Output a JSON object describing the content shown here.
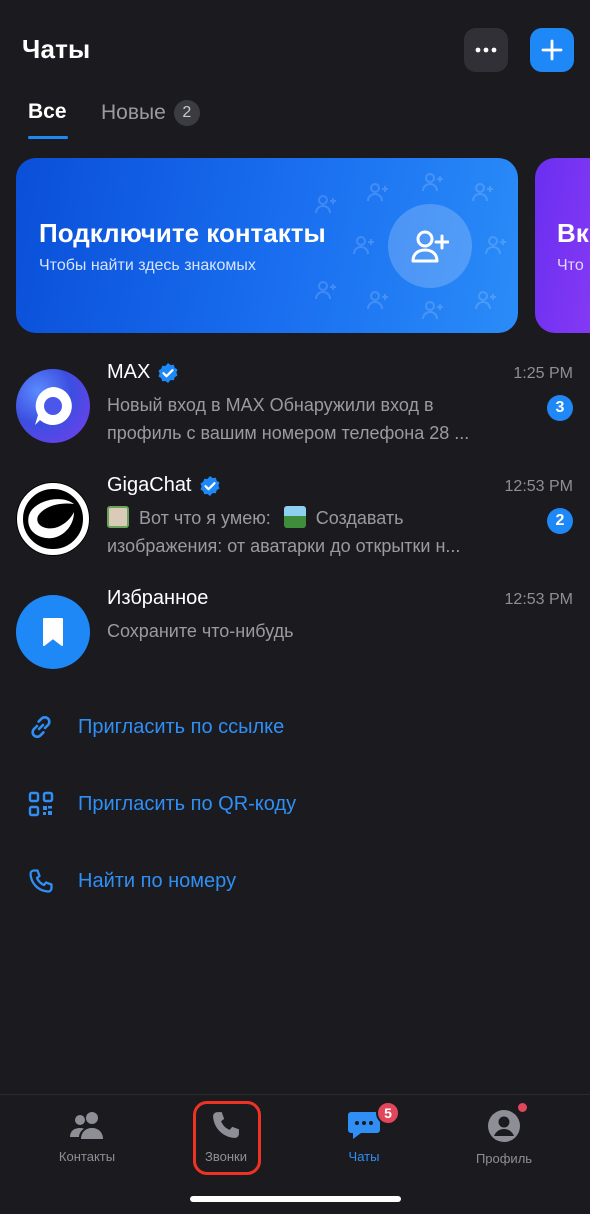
{
  "header": {
    "title": "Чаты",
    "more_icon": "more-horizontal-icon",
    "add_icon": "plus-icon"
  },
  "tabs": [
    {
      "label": "Все",
      "active": true
    },
    {
      "label": "Новые",
      "badge": "2",
      "active": false
    }
  ],
  "banners": [
    {
      "title": "Подключите контакты",
      "subtitle": "Чтобы найти здесь знакомых",
      "icon": "add-contact-icon"
    },
    {
      "title": "Вк",
      "subtitle": "Что"
    }
  ],
  "chats": [
    {
      "name": "MAX",
      "verified": true,
      "time": "1:25 PM",
      "preview_line1": "Новый вход в MAX Обнаружили вход в",
      "preview_line2": "профиль с вашим номером телефона 28 ...",
      "unread": "3"
    },
    {
      "name": "GigaChat",
      "verified": true,
      "time": "12:53 PM",
      "preview_line1": "Вот что я умею:",
      "preview_line1b": "Создавать",
      "preview_line2": "изображения: от аватарки до открытки н...",
      "unread": "2"
    },
    {
      "name": "Избранное",
      "verified": false,
      "time": "12:53 PM",
      "preview_line1": "Сохраните что-нибудь"
    }
  ],
  "actions": [
    {
      "label": "Пригласить по ссылке",
      "icon": "link-icon"
    },
    {
      "label": "Пригласить по QR-коду",
      "icon": "qr-code-icon"
    },
    {
      "label": "Найти по номеру",
      "icon": "phone-icon"
    }
  ],
  "bottom_nav": {
    "items": [
      {
        "label": "Контакты",
        "icon": "contacts-icon"
      },
      {
        "label": "Звонки",
        "icon": "phone-icon"
      },
      {
        "label": "Чаты",
        "icon": "chat-bubble-icon",
        "badge": "5",
        "active": true
      },
      {
        "label": "Профиль",
        "icon": "profile-icon"
      }
    ]
  },
  "colors": {
    "background": "#1b1b1f",
    "accent": "#1e88f7",
    "link": "#2f8ff5",
    "badge_red": "#e0475a",
    "highlight": "#ee3324"
  }
}
